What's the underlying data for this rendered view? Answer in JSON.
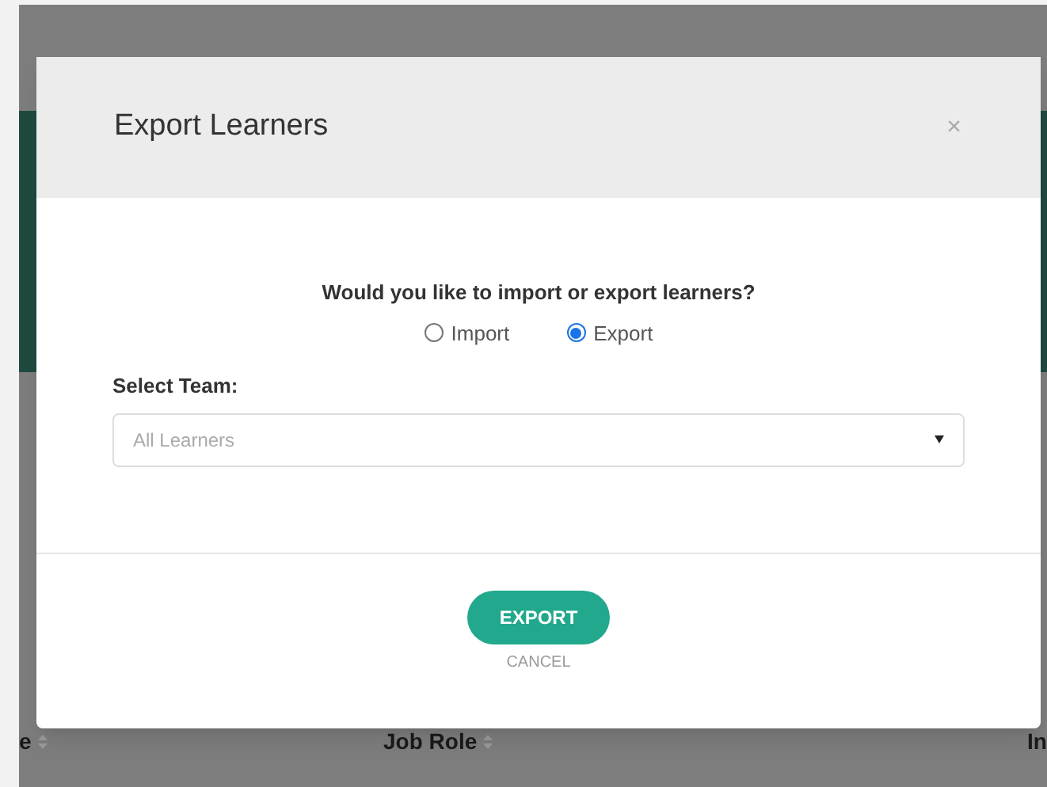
{
  "background_table": {
    "columns": [
      "e",
      "Job Role",
      "In"
    ]
  },
  "dialog": {
    "title": "Export Learners",
    "close": "×",
    "question": "Would you like to import or export learners?",
    "options": [
      {
        "label": "Import",
        "selected": false
      },
      {
        "label": "Export",
        "selected": true
      }
    ],
    "team_label": "Select Team:",
    "team_value": "All Learners",
    "buttons": {
      "primary": "EXPORT",
      "secondary": "CANCEL"
    }
  }
}
